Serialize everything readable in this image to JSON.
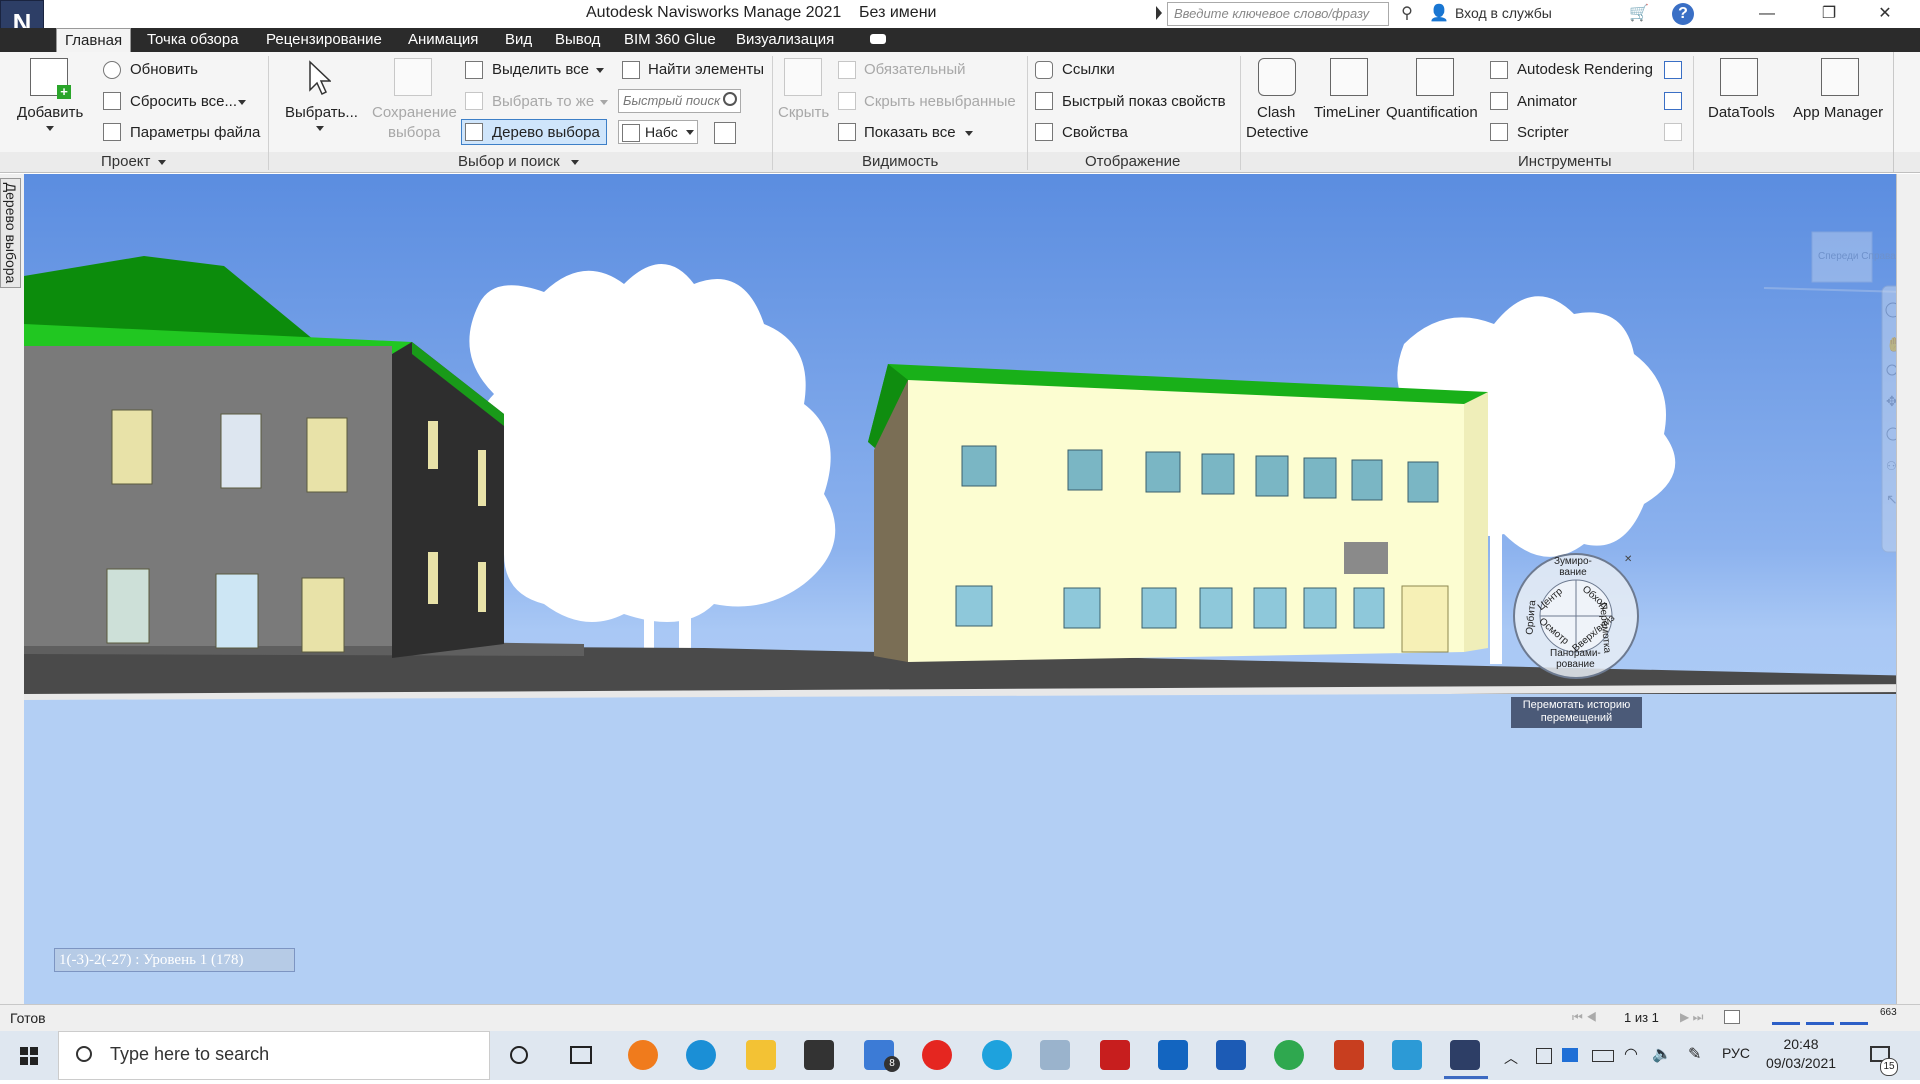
{
  "window": {
    "title": "Autodesk Navisworks Manage 2021    Без имени",
    "search_placeholder": "Введите ключевое слово/фразу",
    "signin": "Вход в службы"
  },
  "tabs": [
    "Главная",
    "Точка обзора",
    "Рецензирование",
    "Анимация",
    "Вид",
    "Вывод",
    "BIM 360 Glue",
    "Визуализация"
  ],
  "ribbon": {
    "project": {
      "title": "Проект",
      "add": "Добавить",
      "refresh": "Обновить",
      "reset_all": "Сбросить все...",
      "file_options": "Параметры файла"
    },
    "select": {
      "title": "Выбор и поиск",
      "select": "Выбрать...",
      "save_selection_1": "Сохранение",
      "save_selection_2": "выбора",
      "select_all": "Выделить все",
      "select_same": "Выбрать то же",
      "selection_tree": "Дерево выбора",
      "find_items": "Найти элементы",
      "quick_find_placeholder": "Быстрый поиск",
      "sets": "Набс"
    },
    "visibility": {
      "title": "Видимость",
      "hide": "Скрыть",
      "required": "Обязательный",
      "hide_unselected": "Скрыть невыбранные",
      "unhide_all": "Показать все"
    },
    "display": {
      "title": "Отображение",
      "links": "Ссылки",
      "quick_properties": "Быстрый  показ свойств",
      "properties": "Свойства"
    },
    "tools": {
      "title": "Инструменты",
      "clash_1": "Clash",
      "clash_2": "Detective",
      "timeliner": "TimeLiner",
      "quantification": "Quantification",
      "rendering": "Autodesk Rendering",
      "animator": "Animator",
      "scripter": "Scripter",
      "datatools": "DataTools",
      "app_manager": "App Manager"
    }
  },
  "side_tab": "Дерево выбора",
  "viewport": {
    "view_label": "1(-3)-2(-27) : Уровень 1 (178)",
    "viewcube_text": "Спереди Справа",
    "wheel": {
      "zoom": "Зумиро-\nвание",
      "center": "Центр",
      "walk": "Обход",
      "rewind": "Перемотка",
      "orbit": "Орбита",
      "look": "Осмотр",
      "updown": "Вверх/вниз",
      "pan": "Панорами-\nрование"
    },
    "tooltip_1": "Перемотать историю",
    "tooltip_2": "перемещений"
  },
  "status": {
    "ready": "Готов",
    "page": "1 из 1",
    "memory": "663"
  },
  "taskbar": {
    "search": "Type here to search",
    "lang": "РУС",
    "time": "20:48",
    "date": "09/03/2021",
    "mail_badge": "8",
    "notif_count": "15"
  },
  "colors": {
    "roof_green": "#1fc21f",
    "sky_top": "#5b8de0",
    "sky_bottom": "#b5d2f7",
    "selection_highlight": "#cfe5fb"
  }
}
